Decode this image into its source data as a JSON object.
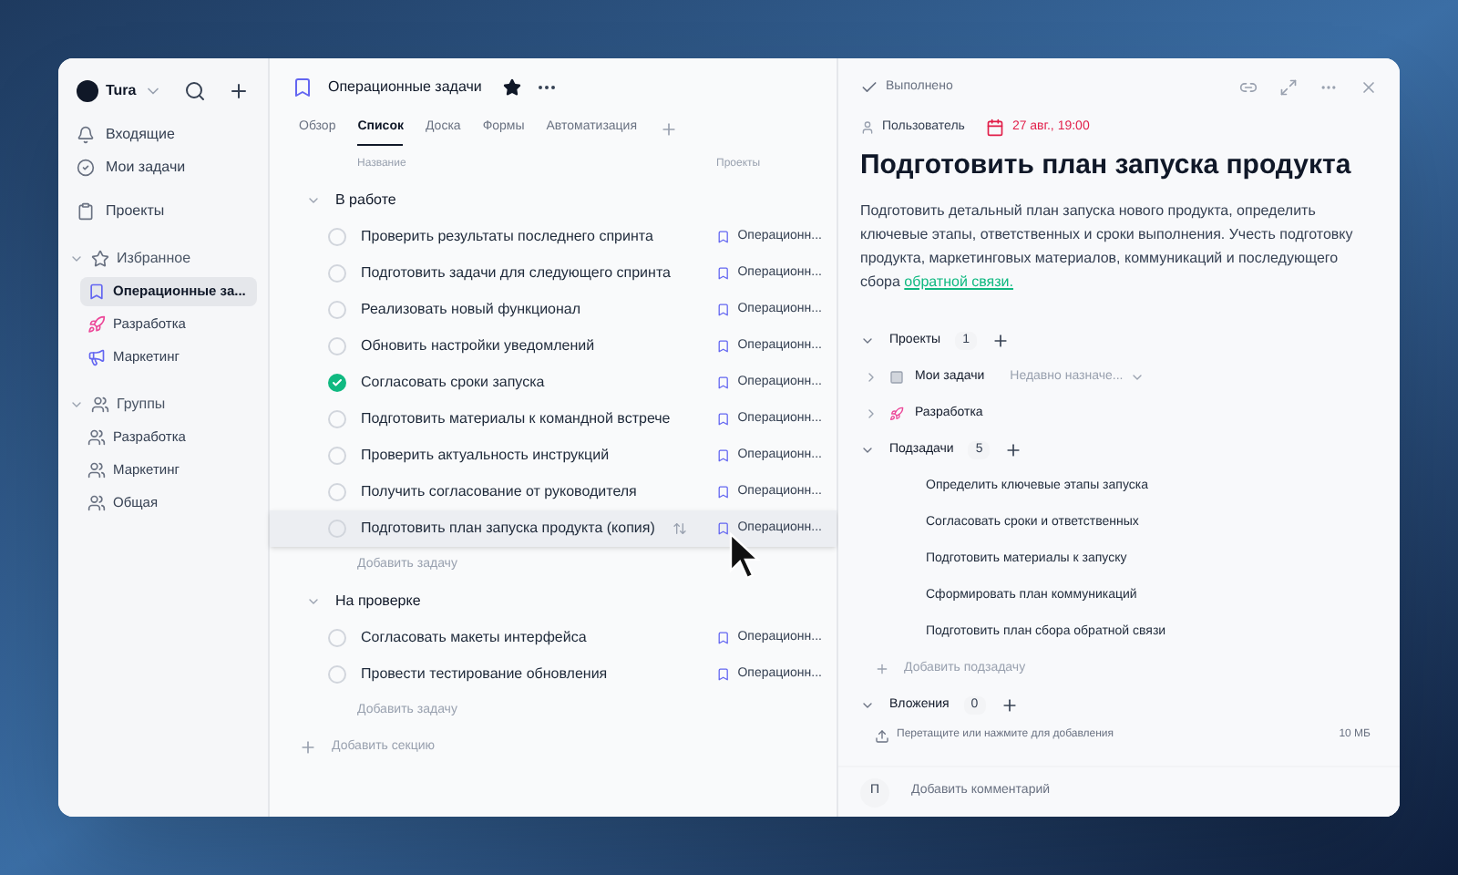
{
  "workspace": {
    "name": "Tura"
  },
  "sidebar": {
    "nav": [
      {
        "kind": "inbox",
        "label": "Входящие",
        "selected": false
      },
      {
        "kind": "tasks",
        "label": "Мои задачи",
        "selected": false
      },
      {
        "kind": "projects",
        "label": "Проекты",
        "selected": false
      }
    ],
    "groups": [
      {
        "kind": "favorites",
        "title": "Избранное",
        "expanded": true,
        "items": [
          {
            "kind": "list",
            "label": "Операционные за...",
            "selected": true
          },
          {
            "kind": "rocket",
            "label": "Разработка",
            "selected": false
          },
          {
            "kind": "megaphone",
            "label": "Маркетинг",
            "selected": false
          }
        ]
      },
      {
        "kind": "teams",
        "title": "Группы",
        "expanded": true,
        "items": [
          {
            "kind": "team",
            "label": "Разработка",
            "selected": false
          },
          {
            "kind": "team",
            "label": "Маркетинг",
            "selected": false
          },
          {
            "kind": "team",
            "label": "Общая",
            "selected": false
          }
        ]
      }
    ]
  },
  "list": {
    "title": "Операционные задачи",
    "starred": true,
    "tabs": [
      {
        "label": "Обзор",
        "selected": false
      },
      {
        "label": "Список",
        "selected": true
      },
      {
        "label": "Доска",
        "selected": false
      },
      {
        "label": "Формы",
        "selected": false
      },
      {
        "label": "Автоматизация",
        "selected": false
      }
    ],
    "columns": [
      "Название",
      "Проекты"
    ],
    "sections": [
      {
        "title": "В работе",
        "expanded": true,
        "add_task": "Добавить задачу",
        "tasks": [
          {
            "name": "Проверить результаты последнего спринта",
            "project": "Операционн...",
            "done": false,
            "highlighted": false
          },
          {
            "name": "Подготовить задачи для следующего спринта",
            "project": "Операционн...",
            "done": false,
            "highlighted": false
          },
          {
            "name": "Реализовать новый функционал",
            "project": "Операционн...",
            "done": false,
            "highlighted": false
          },
          {
            "name": "Обновить настройки уведомлений",
            "project": "Операционн...",
            "done": false,
            "highlighted": false
          },
          {
            "name": "Согласовать сроки запуска",
            "project": "Операционн...",
            "done": true,
            "highlighted": false
          },
          {
            "name": "Подготовить материалы к командной встрече",
            "project": "Операционн...",
            "done": false,
            "highlighted": false
          },
          {
            "name": "Проверить актуальность инструкций",
            "project": "Операционн...",
            "done": false,
            "highlighted": false
          },
          {
            "name": "Получить согласование от руководителя",
            "project": "Операционн...",
            "done": false,
            "highlighted": false
          },
          {
            "name": "Подготовить план запуска продукта (копия)",
            "project": "Операционн...",
            "done": false,
            "highlighted": true
          }
        ]
      },
      {
        "title": "На проверке",
        "expanded": true,
        "add_task": "Добавить задачу",
        "tasks": [
          {
            "name": "Согласовать макеты интерфейса",
            "project": "Операционн...",
            "done": false,
            "highlighted": false
          },
          {
            "name": "Провести тестирование обновления",
            "project": "Операционн...",
            "done": false,
            "highlighted": false
          }
        ]
      }
    ],
    "add_section": "Добавить секцию"
  },
  "detail": {
    "status": "Выполнено",
    "assignee": "Пользователь",
    "due": "27 авг., 19:00",
    "title": "Подготовить план запуска продукта",
    "description": "Подготовить детальный план запуска нового продукта, определить ключевые этапы, ответственных и сроки выполнения. Учесть подготовку продукта, маркетинговых материалов, коммуникаций и последующего сбора",
    "description_link": "обратной связи.",
    "projects": {
      "label": "Проекты",
      "count": "1",
      "expanded": true,
      "items": [
        {
          "kind": "tasks",
          "name": "Мои задачи",
          "section": "Недавно назначе..."
        },
        {
          "kind": "rocket",
          "name": "Разработка"
        }
      ]
    },
    "subtasks": {
      "label": "Подзадачи",
      "count": "5",
      "expanded": true,
      "items": [
        "Определить ключевые этапы запуска",
        "Согласовать сроки и ответственных",
        "Подготовить материалы к запуску",
        "Сформировать план коммуникаций",
        "Подготовить план сбора обратной связи"
      ],
      "add": "Добавить подзадачу"
    },
    "attachments": {
      "label": "Вложения",
      "count": "0",
      "expanded": true,
      "hint": "Перетащите или нажмите для добавления",
      "limit": "10 МБ"
    },
    "comment": {
      "avatar": "П",
      "placeholder": "Добавить комментарий"
    }
  }
}
